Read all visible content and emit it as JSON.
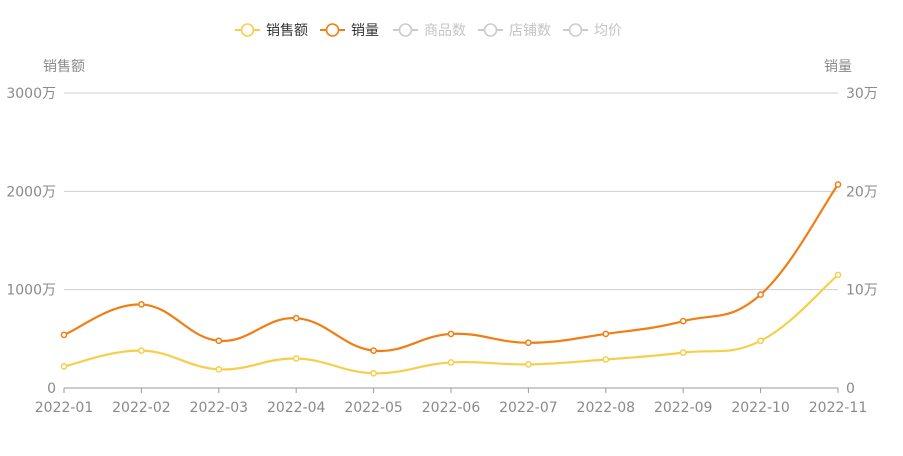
{
  "chart_data": {
    "type": "line",
    "categories": [
      "2022-01",
      "2022-02",
      "2022-03",
      "2022-04",
      "2022-05",
      "2022-06",
      "2022-07",
      "2022-08",
      "2022-09",
      "2022-10",
      "2022-11"
    ],
    "y_left": {
      "label": "销售额",
      "range": [
        0,
        3000
      ],
      "ticks": [
        0,
        1000,
        2000,
        3000
      ],
      "tick_labels": [
        "0",
        "1000万",
        "2000万",
        "3000万"
      ],
      "unit": "万"
    },
    "y_right": {
      "label": "销量",
      "range": [
        0,
        30
      ],
      "ticks": [
        0,
        10,
        20,
        30
      ],
      "tick_labels": [
        "0",
        "10万",
        "20万",
        "30万"
      ],
      "unit": "万"
    },
    "legend": [
      {
        "name": "销售额",
        "active": true,
        "color": "#f5cf4b"
      },
      {
        "name": "销量",
        "active": true,
        "color": "#f07e14"
      },
      {
        "name": "商品数",
        "active": false,
        "color": "#cccccc"
      },
      {
        "name": "店铺数",
        "active": false,
        "color": "#cccccc"
      },
      {
        "name": "均价",
        "active": false,
        "color": "#cccccc"
      }
    ],
    "legend_position": "top-center",
    "grid": true,
    "series": [
      {
        "name": "销售额",
        "axis": "left",
        "color": "#f5cf4b",
        "values": [
          220,
          380,
          190,
          300,
          150,
          260,
          240,
          290,
          360,
          480,
          1150
        ]
      },
      {
        "name": "销量",
        "axis": "right",
        "color": "#f07e14",
        "values": [
          5.4,
          8.5,
          4.8,
          7.1,
          3.8,
          5.5,
          4.6,
          5.5,
          6.8,
          9.5,
          20.7
        ]
      }
    ]
  }
}
